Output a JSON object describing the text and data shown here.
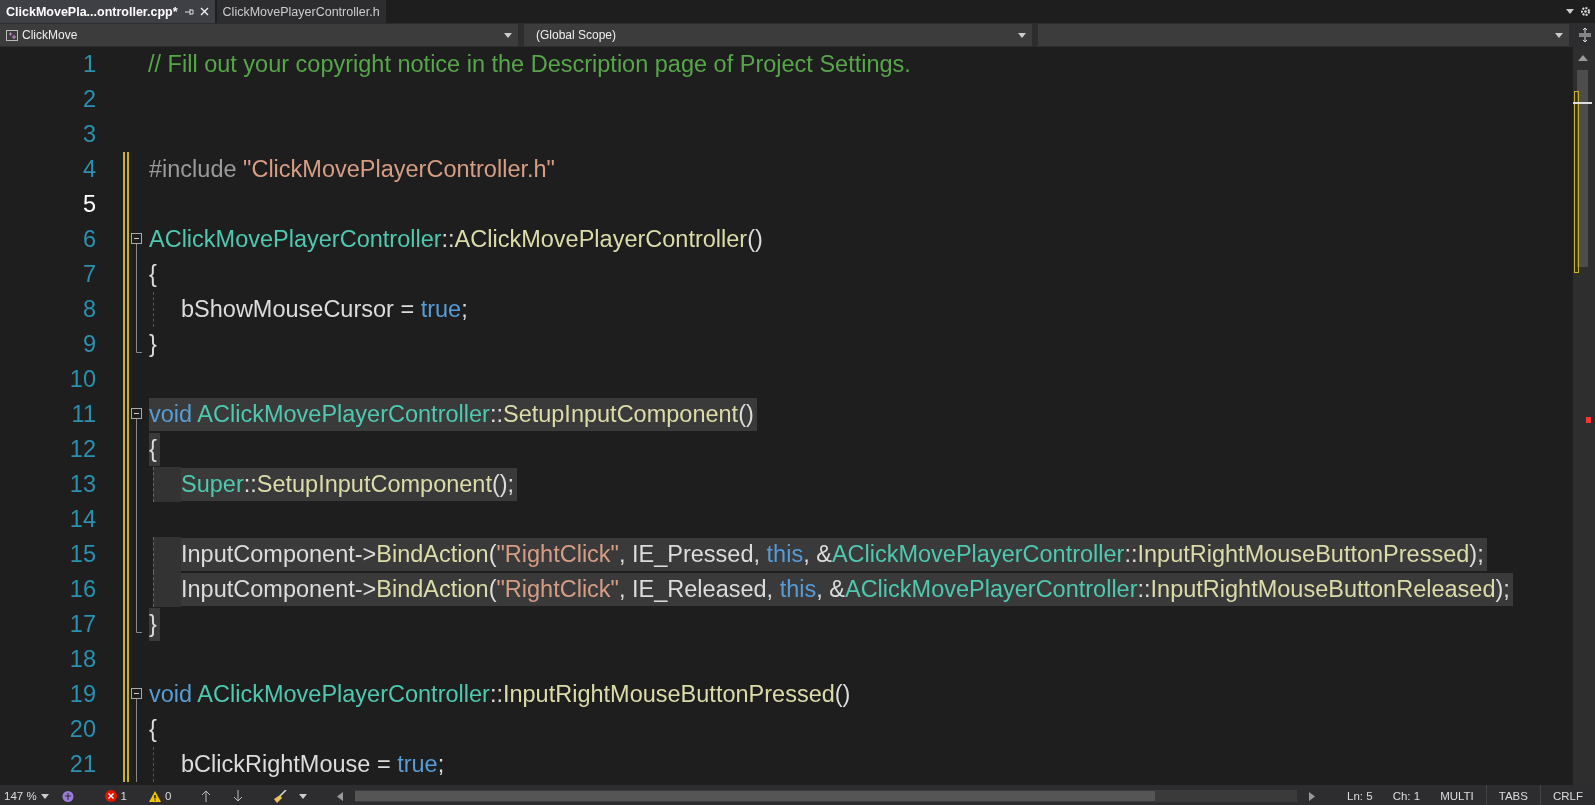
{
  "tabs": [
    {
      "label": "ClickMovePla...ontroller.cpp*",
      "selected": true
    },
    {
      "label": "ClickMovePlayerController.h",
      "selected": false
    }
  ],
  "nav": {
    "project": "ClickMove",
    "scope": "(Global Scope)"
  },
  "editor": {
    "lines": [
      {
        "number": "1",
        "kind": "plain",
        "current": false,
        "changed": false,
        "indented": false,
        "highlighted": false,
        "tokens": [
          {
            "kind": "comment",
            "text": "// Fill out your copyright notice in the Description page of Project Settings."
          }
        ]
      },
      {
        "number": "2",
        "kind": "plain",
        "current": false,
        "changed": false,
        "indented": false
      },
      {
        "number": "3",
        "kind": "plain",
        "current": false,
        "changed": false,
        "indented": false
      },
      {
        "number": "4",
        "kind": "plain",
        "current": false,
        "changed": true,
        "indented": false,
        "highlighted": false,
        "tokens": [
          {
            "kind": "preproc",
            "text": "#include "
          },
          {
            "kind": "string",
            "text": "\"ClickMovePlayerController.h\""
          }
        ]
      },
      {
        "number": "5",
        "kind": "plain",
        "current": true,
        "changed": true,
        "indented": false
      },
      {
        "number": "6",
        "kind": "start",
        "current": false,
        "changed": true,
        "indented": false,
        "highlighted": false,
        "tokens": [
          {
            "kind": "type",
            "text": "AClickMovePlayerController"
          },
          {
            "kind": "plain",
            "text": "::"
          },
          {
            "kind": "func",
            "text": "AClickMovePlayerController"
          },
          {
            "kind": "plain",
            "text": "()"
          }
        ]
      },
      {
        "number": "7",
        "kind": "inner",
        "current": false,
        "changed": true,
        "indented": false,
        "highlighted": false,
        "tokens": [
          {
            "kind": "plain",
            "text": "{"
          }
        ]
      },
      {
        "number": "8",
        "kind": "inner",
        "current": false,
        "changed": true,
        "indented": true,
        "highlighted": false,
        "tokens": [
          {
            "kind": "plain",
            "text": "bShowMouseCursor = "
          },
          {
            "kind": "keyword",
            "text": "true"
          },
          {
            "kind": "plain",
            "text": ";"
          }
        ]
      },
      {
        "number": "9",
        "kind": "end",
        "current": false,
        "changed": true,
        "indented": false,
        "highlighted": false,
        "tokens": [
          {
            "kind": "plain",
            "text": "}"
          }
        ]
      },
      {
        "number": "10",
        "kind": "plain",
        "current": false,
        "changed": true,
        "indented": false
      },
      {
        "number": "11",
        "kind": "start",
        "current": false,
        "changed": true,
        "indented": false,
        "highlighted": true,
        "tokens": [
          {
            "kind": "keyword",
            "text": "void "
          },
          {
            "kind": "type",
            "text": "AClickMovePlayerController"
          },
          {
            "kind": "plain",
            "text": "::"
          },
          {
            "kind": "func",
            "text": "SetupInputComponent"
          },
          {
            "kind": "plain",
            "text": "()"
          }
        ]
      },
      {
        "number": "12",
        "kind": "inner",
        "current": false,
        "changed": true,
        "indented": false,
        "highlighted": true,
        "tokens": [
          {
            "kind": "plain",
            "text": "{"
          }
        ]
      },
      {
        "number": "13",
        "kind": "inner",
        "current": false,
        "changed": true,
        "indented": true,
        "highlighted": true,
        "tokens": [
          {
            "kind": "type",
            "text": "Super"
          },
          {
            "kind": "plain",
            "text": "::"
          },
          {
            "kind": "func",
            "text": "SetupInputComponent"
          },
          {
            "kind": "plain",
            "text": "();"
          }
        ]
      },
      {
        "number": "14",
        "kind": "inner",
        "current": false,
        "changed": true,
        "indented": false
      },
      {
        "number": "15",
        "kind": "inner",
        "current": false,
        "changed": true,
        "indented": true,
        "highlighted": true,
        "tokens": [
          {
            "kind": "plain",
            "text": "InputComponent->"
          },
          {
            "kind": "func",
            "text": "BindAction"
          },
          {
            "kind": "plain",
            "text": "("
          },
          {
            "kind": "string",
            "text": "\"RightClick\""
          },
          {
            "kind": "plain",
            "text": ", IE_Pressed, "
          },
          {
            "kind": "keyword",
            "text": "this"
          },
          {
            "kind": "plain",
            "text": ", &"
          },
          {
            "kind": "type",
            "text": "AClickMovePlayerController"
          },
          {
            "kind": "plain",
            "text": "::"
          },
          {
            "kind": "func",
            "text": "InputRightMouseButtonPressed"
          },
          {
            "kind": "plain",
            "text": ");"
          }
        ]
      },
      {
        "number": "16",
        "kind": "inner",
        "current": false,
        "changed": true,
        "indented": true,
        "highlighted": true,
        "tokens": [
          {
            "kind": "plain",
            "text": "InputComponent->"
          },
          {
            "kind": "func",
            "text": "BindAction"
          },
          {
            "kind": "plain",
            "text": "("
          },
          {
            "kind": "string",
            "text": "\"RightClick\""
          },
          {
            "kind": "plain",
            "text": ", IE_Released, "
          },
          {
            "kind": "keyword",
            "text": "this"
          },
          {
            "kind": "plain",
            "text": ", &"
          },
          {
            "kind": "type",
            "text": "AClickMovePlayerController"
          },
          {
            "kind": "plain",
            "text": "::"
          },
          {
            "kind": "func",
            "text": "InputRightMouseButtonReleased"
          },
          {
            "kind": "plain",
            "text": ");"
          }
        ]
      },
      {
        "number": "17",
        "kind": "end",
        "current": false,
        "changed": true,
        "indented": false,
        "highlighted": true,
        "tokens": [
          {
            "kind": "plain",
            "text": "}"
          }
        ]
      },
      {
        "number": "18",
        "kind": "plain",
        "current": false,
        "changed": true,
        "indented": false
      },
      {
        "number": "19",
        "kind": "start",
        "current": false,
        "changed": true,
        "indented": false,
        "highlighted": false,
        "tokens": [
          {
            "kind": "keyword",
            "text": "void "
          },
          {
            "kind": "type",
            "text": "AClickMovePlayerController"
          },
          {
            "kind": "plain",
            "text": "::"
          },
          {
            "kind": "func",
            "text": "InputRightMouseButtonPressed"
          },
          {
            "kind": "plain",
            "text": "()"
          }
        ]
      },
      {
        "number": "20",
        "kind": "inner",
        "current": false,
        "changed": true,
        "indented": false,
        "highlighted": false,
        "tokens": [
          {
            "kind": "plain",
            "text": "{"
          }
        ]
      },
      {
        "number": "21",
        "kind": "inner",
        "current": false,
        "changed": true,
        "indented": true,
        "highlighted": false,
        "tokens": [
          {
            "kind": "plain",
            "text": "bClickRightMouse = "
          },
          {
            "kind": "keyword",
            "text": "true"
          },
          {
            "kind": "plain",
            "text": ";"
          }
        ]
      }
    ]
  },
  "status_bar": {
    "zoom": "147 %",
    "errors": "1",
    "warnings": "0",
    "line": "Ln: 5",
    "column": "Ch: 1",
    "mode": "MULTI",
    "indent": "TABS",
    "line_ending": "CRLF"
  }
}
